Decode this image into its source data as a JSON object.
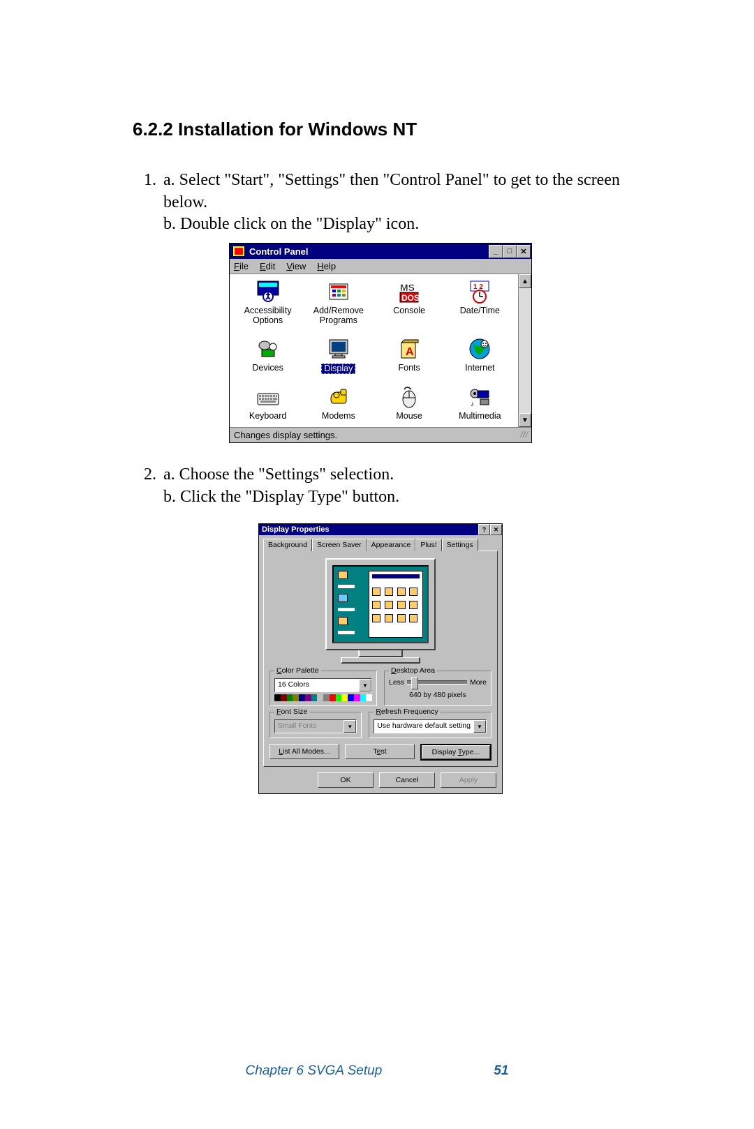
{
  "section_heading": "6.2.2 Installation for Windows NT",
  "step1_num": "1.",
  "step1_a": "a. Select \"Start\", \"Settings\" then \"Control Panel\" to get to the screen below.",
  "step1_b": "b. Double click on the \"Display\" icon.",
  "step2_num": "2.",
  "step2_a": "a. Choose the \"Settings\" selection.",
  "step2_b": "b. Click the \"Display Type\" button.",
  "cp": {
    "title": "Control Panel",
    "menus": {
      "file": "File",
      "edit": "Edit",
      "view": "View",
      "help": "Help"
    },
    "items": [
      {
        "label": "Accessibility Options"
      },
      {
        "label": "Add/Remove Programs"
      },
      {
        "label": "Console"
      },
      {
        "label": "Date/Time"
      },
      {
        "label": "Devices"
      },
      {
        "label": "Display",
        "selected": true
      },
      {
        "label": "Fonts"
      },
      {
        "label": "Internet"
      },
      {
        "label": "Keyboard"
      },
      {
        "label": "Modems"
      },
      {
        "label": "Mouse"
      },
      {
        "label": "Multimedia"
      }
    ],
    "status": "Changes display settings."
  },
  "dp": {
    "title": "Display Properties",
    "tabs": {
      "background": "Background",
      "screensaver": "Screen Saver",
      "appearance": "Appearance",
      "plus": "Plus!",
      "settings": "Settings"
    },
    "color_palette": {
      "legend": "Color Palette",
      "value": "16 Colors"
    },
    "desktop_area": {
      "legend": "Desktop Area",
      "less": "Less",
      "more": "More",
      "resolution": "640 by 480 pixels"
    },
    "font_size": {
      "legend": "Font Size",
      "value": "Small Fonts"
    },
    "refresh": {
      "legend": "Refresh Frequency",
      "value": "Use hardware default setting"
    },
    "buttons": {
      "list_modes": "List All Modes...",
      "test": "Test",
      "display_type": "Display Type...",
      "ok": "OK",
      "cancel": "Cancel",
      "apply": "Apply"
    }
  },
  "footer": {
    "chapter": "Chapter 6   SVGA Setup",
    "page": "51"
  }
}
